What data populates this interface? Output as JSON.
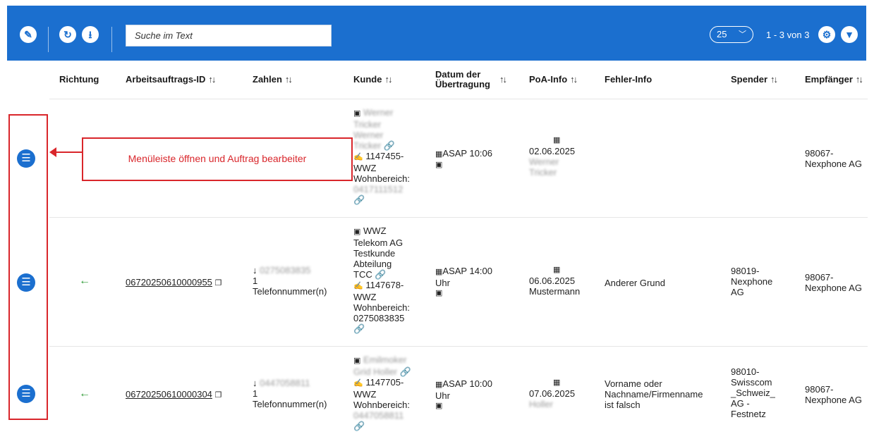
{
  "toolbar": {
    "search_placeholder": "Suche im Text",
    "page_size": "25",
    "page_info": "1 - 3 von 3",
    "icons": [
      "edit-icon",
      "refresh-icon",
      "download-icon",
      "settings-icon",
      "filter-icon"
    ]
  },
  "columns": {
    "richtung": "Richtung",
    "auftrags_id": "Arbeitsauftrags-ID",
    "zahlen": "Zahlen",
    "kunde": "Kunde",
    "datum_1": "Datum der",
    "datum_2": "Übertragung",
    "poa": "PoA-Info",
    "fehler": "Fehler-Info",
    "spender": "Spender",
    "empfaenger": "Empfänger"
  },
  "sort_glyph": "↑↓",
  "callout": {
    "text": "Menüleiste öffnen und Auftrag bearbeiter"
  },
  "rows": [
    {
      "kunde_name_1": "Werner",
      "kunde_name_2": "Tricker",
      "kunde_name_3": "Werner",
      "kunde_name_4": "Tricker",
      "kunde_id": "1147455-",
      "kunde_id_2": "WWZ",
      "kunde_bereich": "Wohnbereich:",
      "kunde_nr": "0417111512",
      "datum": "ASAP 10:06",
      "poa_date": "02.06.2025",
      "poa_name_1": "Werner",
      "poa_name_2": "Tricker",
      "empfaenger_1": "98067-",
      "empfaenger_2": "Nexphone AG"
    },
    {
      "richtung_icon": "←",
      "auftrags_id": "06720250610000955",
      "zahlen_nr": "0275083835",
      "zahlen_count": "1",
      "zahlen_label": "Telefonnummer(n)",
      "kunde_name_1": "WWZ",
      "kunde_name_2": "Telekom AG",
      "kunde_name_3": "Testkunde",
      "kunde_name_4": "Abteilung",
      "kunde_name_5": "TCC",
      "kunde_id": "1147678-",
      "kunde_id_2": "WWZ",
      "kunde_bereich": "Wohnbereich:",
      "kunde_nr": "0275083835",
      "datum_1": "ASAP 14:00",
      "datum_2": "Uhr",
      "poa_date": "06.06.2025",
      "poa_name": "Mustermann",
      "fehler": "Anderer Grund",
      "spender_1": "98019-",
      "spender_2": "Nexphone",
      "spender_3": "AG",
      "empfaenger_1": "98067-",
      "empfaenger_2": "Nexphone AG"
    },
    {
      "richtung_icon": "←",
      "auftrags_id": "06720250610000304",
      "zahlen_nr": "0447058811",
      "zahlen_count": "1",
      "zahlen_label": "Telefonnummer(n)",
      "kunde_name_1": "Emilmoker",
      "kunde_name_2": "Grid Holler",
      "kunde_id": "1147705-",
      "kunde_id_2": "WWZ",
      "kunde_bereich": "Wohnbereich:",
      "kunde_nr": "0447058811",
      "datum_1": "ASAP 10:00",
      "datum_2": "Uhr",
      "poa_date": "07.06.2025",
      "poa_name": "Holler",
      "fehler_1": "Vorname oder",
      "fehler_2": "Nachname/Firmenname",
      "fehler_3": "ist falsch",
      "spender_1": "98010-",
      "spender_2": "Swisscom",
      "spender_3": "_Schweiz_",
      "spender_4": "AG -",
      "spender_5": "Festnetz",
      "empfaenger_1": "98067-",
      "empfaenger_2": "Nexphone AG"
    }
  ]
}
